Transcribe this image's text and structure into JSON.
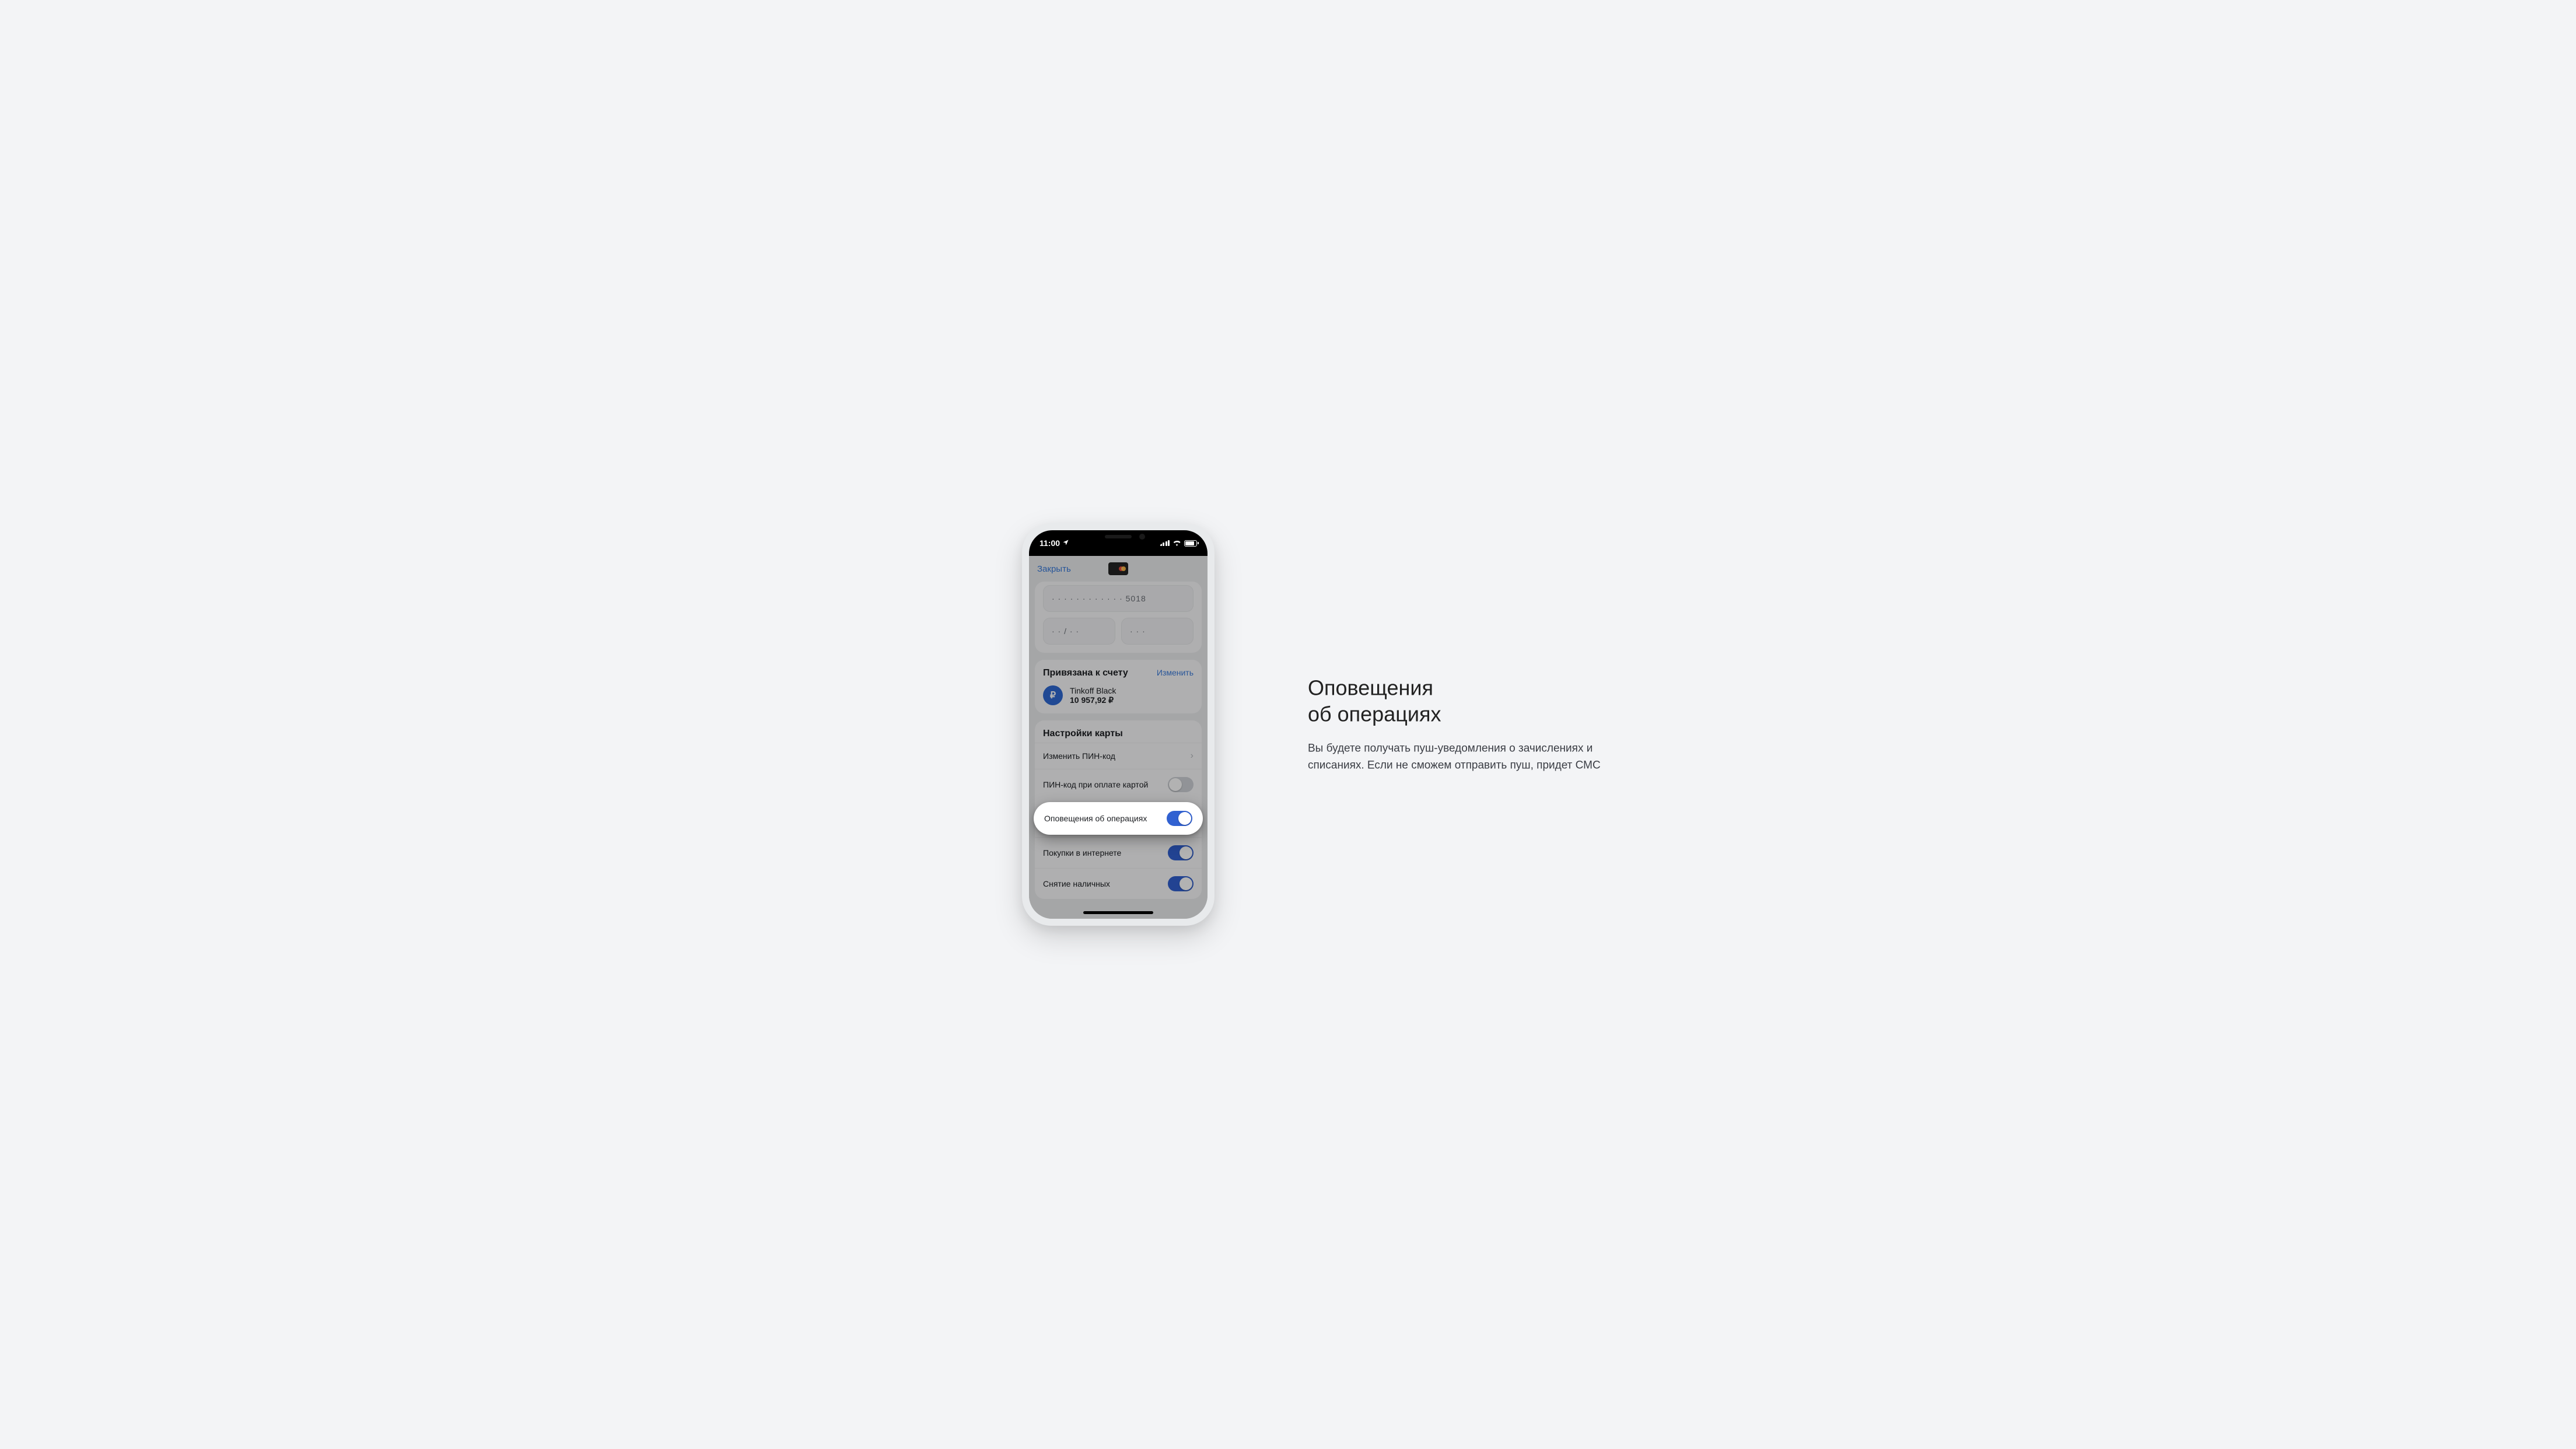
{
  "statusbar": {
    "time": "11:00"
  },
  "nav": {
    "close": "Закрыть"
  },
  "card_info": {
    "number_masked": "· · · ·   · · · ·   · · · · 5018",
    "expiry_masked": "· ·  /  · ·",
    "cvc_masked": "· · ·"
  },
  "linked": {
    "title": "Привязана к счету",
    "change": "Изменить",
    "account_name": "Tinkoff Black",
    "balance": "10 957,92 ₽",
    "icon_char": "₽"
  },
  "settings": {
    "title": "Настройки карты",
    "rows": {
      "change_pin": "Изменить ПИН-код",
      "pin_on_pay": "ПИН-код при оплате картой",
      "notifications": "Оповещения об операциях",
      "online_purchases": "Покупки в интернете",
      "cash_withdraw": "Снятие наличных"
    },
    "states": {
      "pin_on_pay": false,
      "notifications": true,
      "online_purchases": true,
      "cash_withdraw": true
    }
  },
  "annotation": {
    "title_line1": "Оповещения",
    "title_line2": "об операциях",
    "body": "Вы будете получать пуш-уведомления о зачислениях и списаниях. Если не сможем отправить пуш, придет СМС"
  }
}
